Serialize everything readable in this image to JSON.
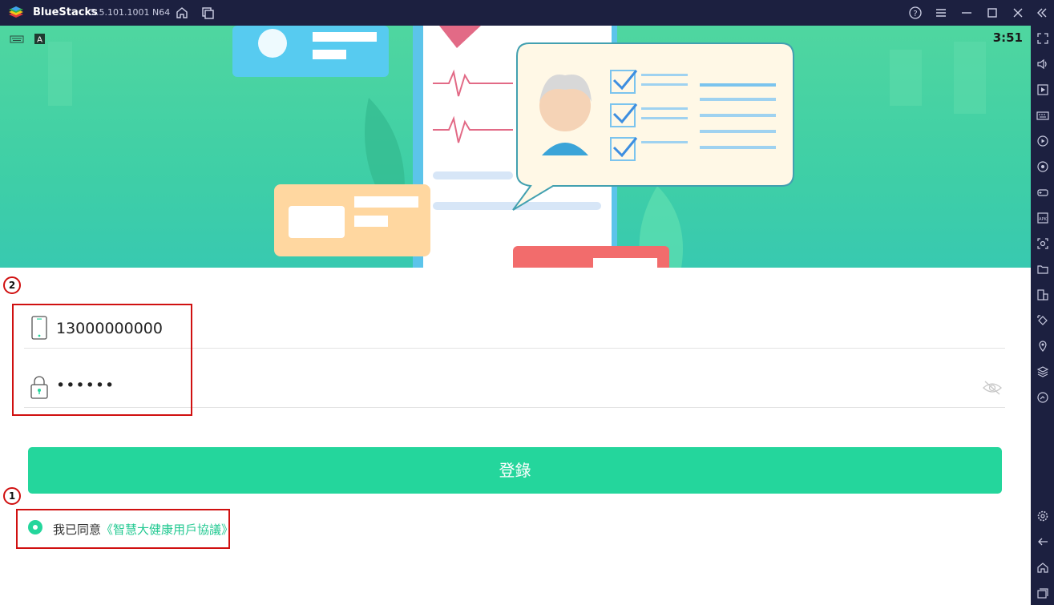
{
  "window": {
    "app_name": "BlueStacks",
    "version": "5.5.101.1001 N64"
  },
  "statusbar": {
    "time": "3:51"
  },
  "login": {
    "phone_value": "13000000000",
    "password_value": "••••••",
    "login_label": "登錄",
    "agree_prefix": "我已同意",
    "agree_link": "《智慧大健康用戶協議》"
  },
  "annotations": {
    "one": "1",
    "two": "2"
  },
  "colors": {
    "accent": "#24d69c",
    "titlebar": "#1c2040",
    "annotation": "#d01010"
  },
  "icons": {
    "titlebar": [
      "home-icon",
      "multi-instance-icon",
      "help-icon",
      "menu-icon",
      "minimize-icon",
      "maximize-icon",
      "close-icon",
      "collapse-sidebar-icon"
    ],
    "sidebar": [
      "fullscreen-icon",
      "volume-icon",
      "media-manager-icon",
      "keyboard-controls-icon",
      "macro-icon",
      "sync-icon",
      "gamepad-icon",
      "apk-install-icon",
      "screenshot-icon",
      "folder-icon",
      "multi-instance-sync-icon",
      "rotate-icon",
      "location-icon",
      "layers-icon",
      "eco-mode-icon",
      "settings-icon",
      "back-icon",
      "home-icon",
      "recents-icon"
    ]
  }
}
